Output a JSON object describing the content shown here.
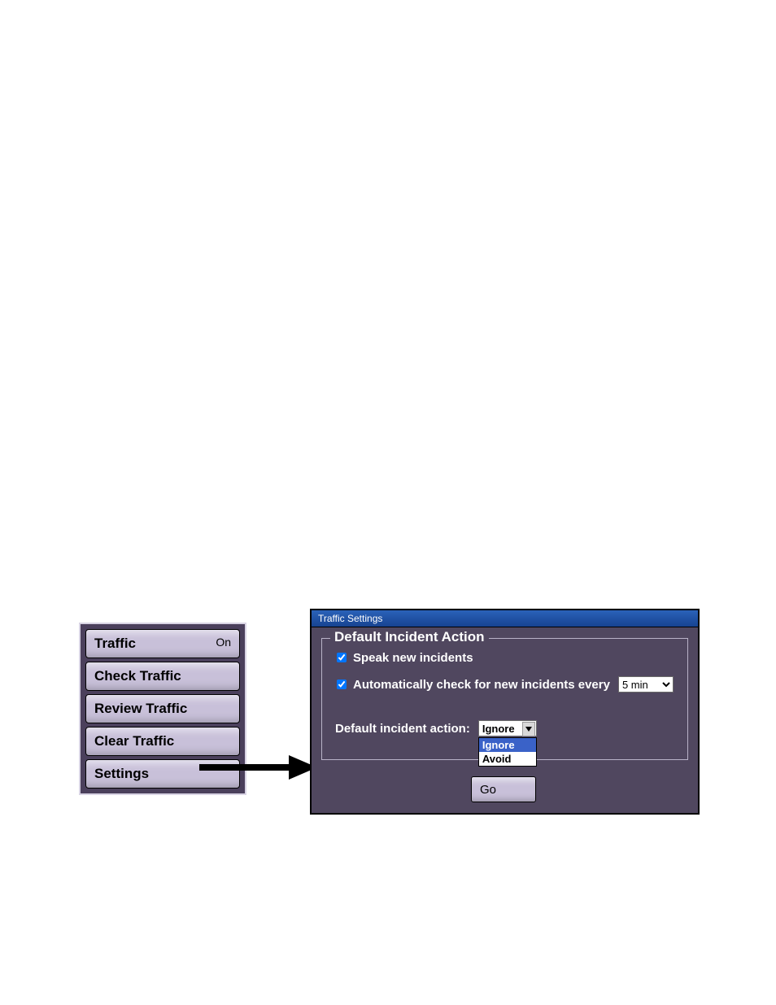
{
  "menu": {
    "items": [
      {
        "label": "Traffic",
        "status": "On"
      },
      {
        "label": "Check Traffic"
      },
      {
        "label": "Review Traffic"
      },
      {
        "label": "Clear Traffic"
      },
      {
        "label": "Settings"
      }
    ]
  },
  "dialog": {
    "title": "Traffic Settings",
    "group_title": "Default Incident Action",
    "speak_label": "Speak new incidents",
    "auto_label": "Automatically check for new incidents every",
    "interval_value": "5 min",
    "action_label": "Default incident action:",
    "action_value": "Ignore",
    "action_options": [
      "Ignore",
      "Avoid"
    ],
    "go_label": "Go"
  }
}
